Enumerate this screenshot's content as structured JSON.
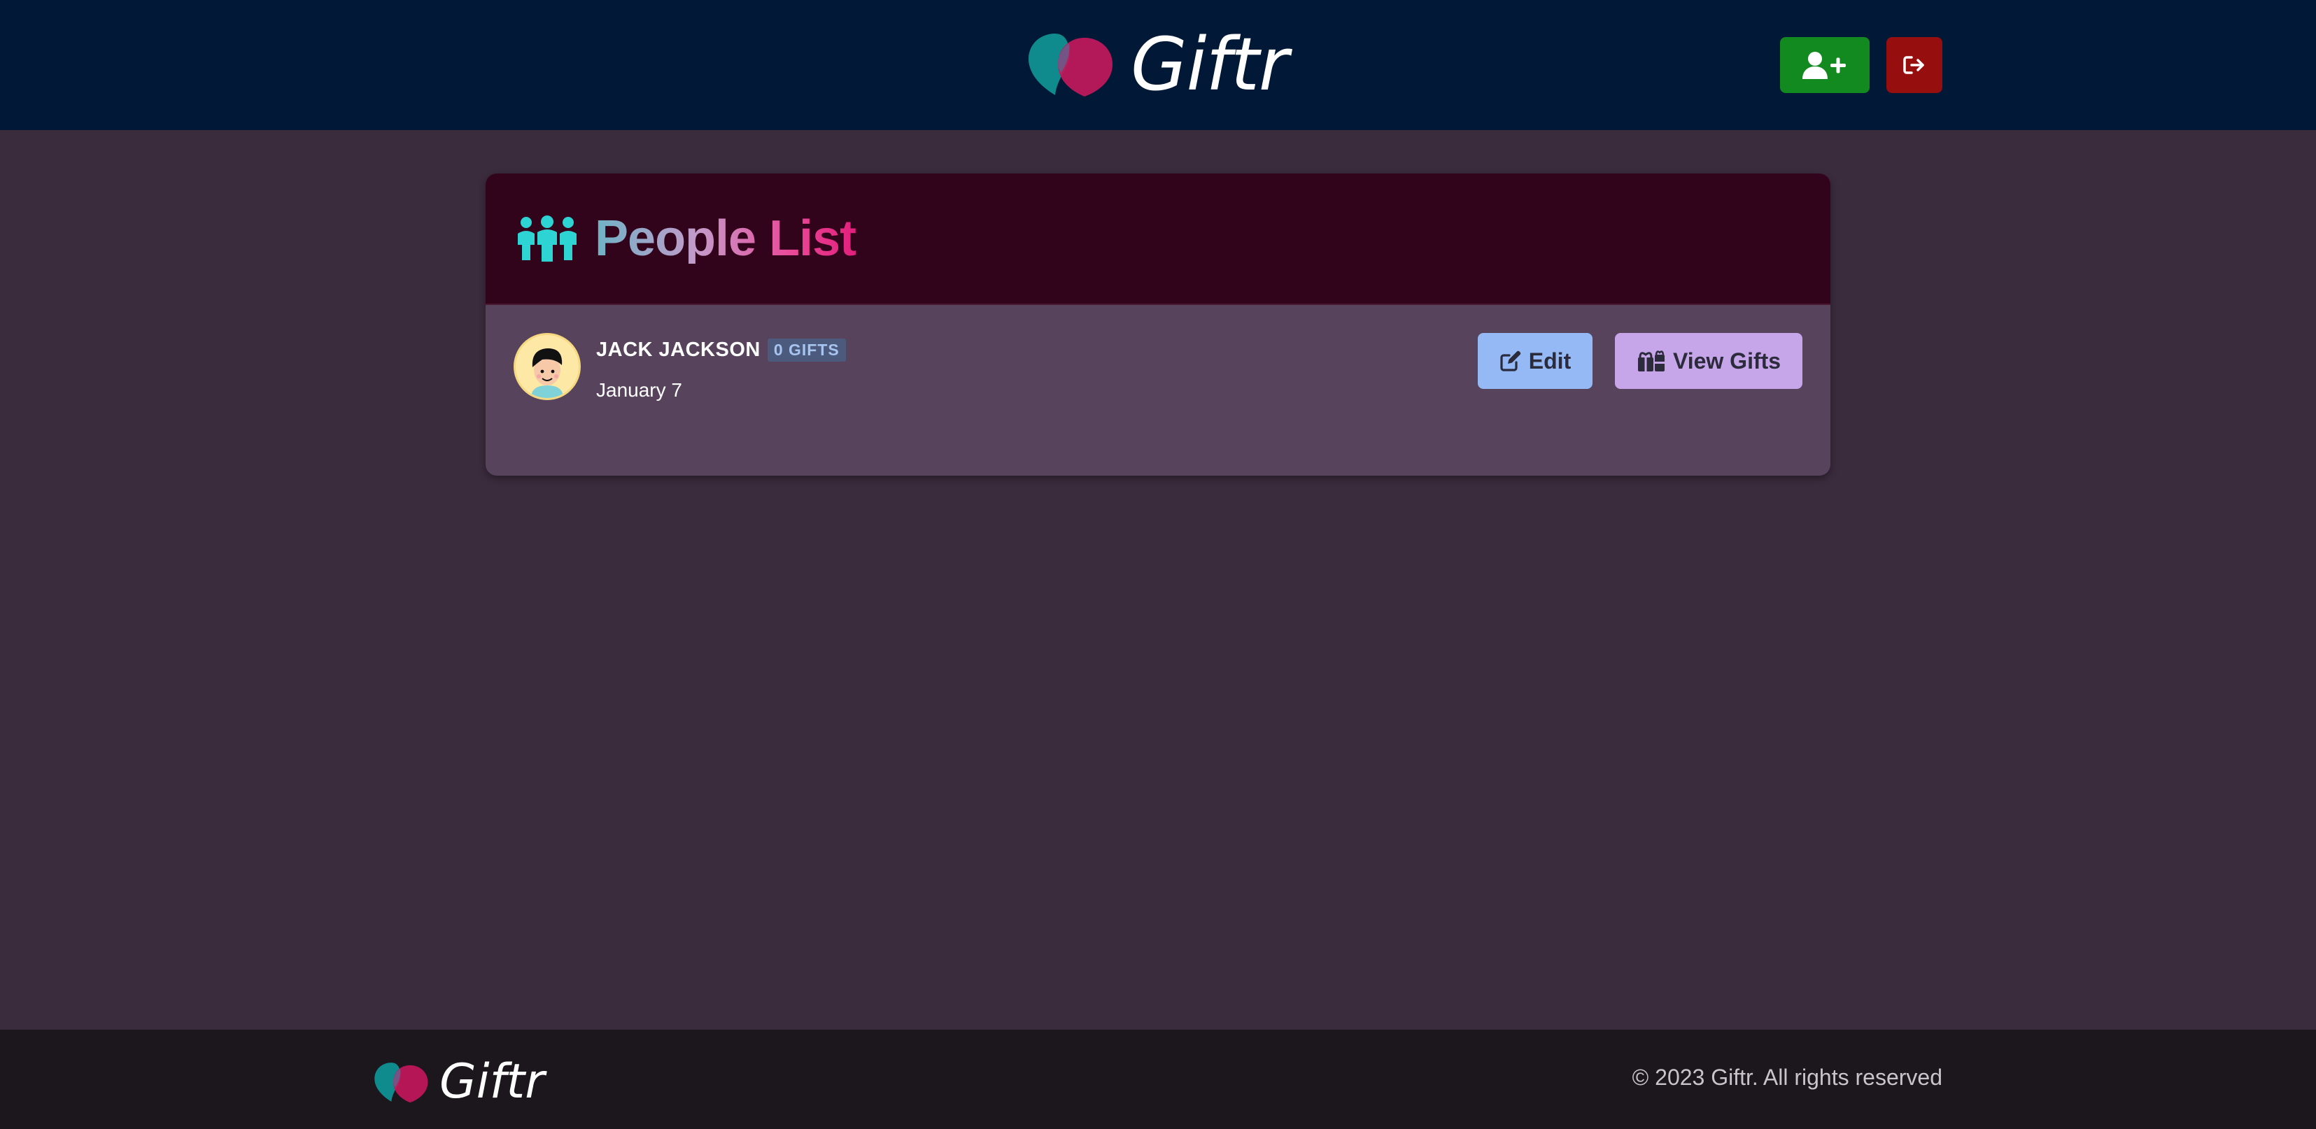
{
  "header": {
    "brand_name": "Giftr",
    "add_person_icon": "user-plus-icon",
    "logout_icon": "sign-out-icon"
  },
  "people_list": {
    "title": "People List",
    "title_icon": "people-group-icon",
    "people": [
      {
        "name": "JACK JACKSON",
        "gift_count_label": "0 GIFTS",
        "date_of_birth": "January 7",
        "edit_label": "Edit",
        "view_gifts_label": "View Gifts"
      }
    ]
  },
  "footer": {
    "brand_name": "Giftr",
    "copyright": "© 2023 Giftr. All rights reserved"
  },
  "colors": {
    "header_bg": "#011936",
    "page_bg": "#3a2b3d",
    "card_header_bg": "#32041b",
    "card_body_bg": "#57445c",
    "add_button": "#138a1f",
    "logout_button": "#960e0e",
    "edit_button": "#94b9f5",
    "view_gifts_button": "#c6a6e8",
    "footer_bg": "#1c161d",
    "logo_teal": "#0f8b8d",
    "logo_magenta": "#c2185b"
  }
}
